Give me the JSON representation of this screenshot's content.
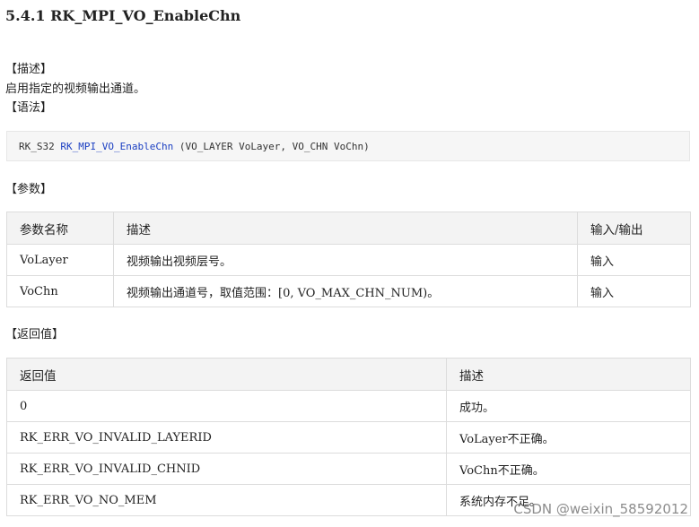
{
  "title": "5.4.1 RK_MPI_VO_EnableChn",
  "description_label": "【描述】",
  "description_text": "启用指定的视频输出通道。",
  "syntax_label": "【语法】",
  "code": {
    "return_type": "RK_S32",
    "function_name": "RK_MPI_VO_EnableChn",
    "args": "(VO_LAYER VoLayer, VO_CHN VoChn)"
  },
  "params_label": "【参数】",
  "params_table": {
    "headers": [
      "参数名称",
      "描述",
      "输入/输出"
    ],
    "rows": [
      [
        "VoLayer",
        "视频输出视频层号。",
        "输入"
      ],
      [
        "VoChn",
        "视频输出通道号，取值范围：[0, VO_MAX_CHN_NUM)。",
        "输入"
      ]
    ]
  },
  "return_label": "【返回值】",
  "return_table": {
    "headers": [
      "返回值",
      "描述"
    ],
    "rows": [
      [
        "0",
        "成功。"
      ],
      [
        "RK_ERR_VO_INVALID_LAYERID",
        "VoLayer不正确。"
      ],
      [
        "RK_ERR_VO_INVALID_CHNID",
        "VoChn不正确。"
      ],
      [
        "RK_ERR_VO_NO_MEM",
        "系统内存不足。"
      ]
    ]
  },
  "watermark": "CSDN @weixin_58592012"
}
